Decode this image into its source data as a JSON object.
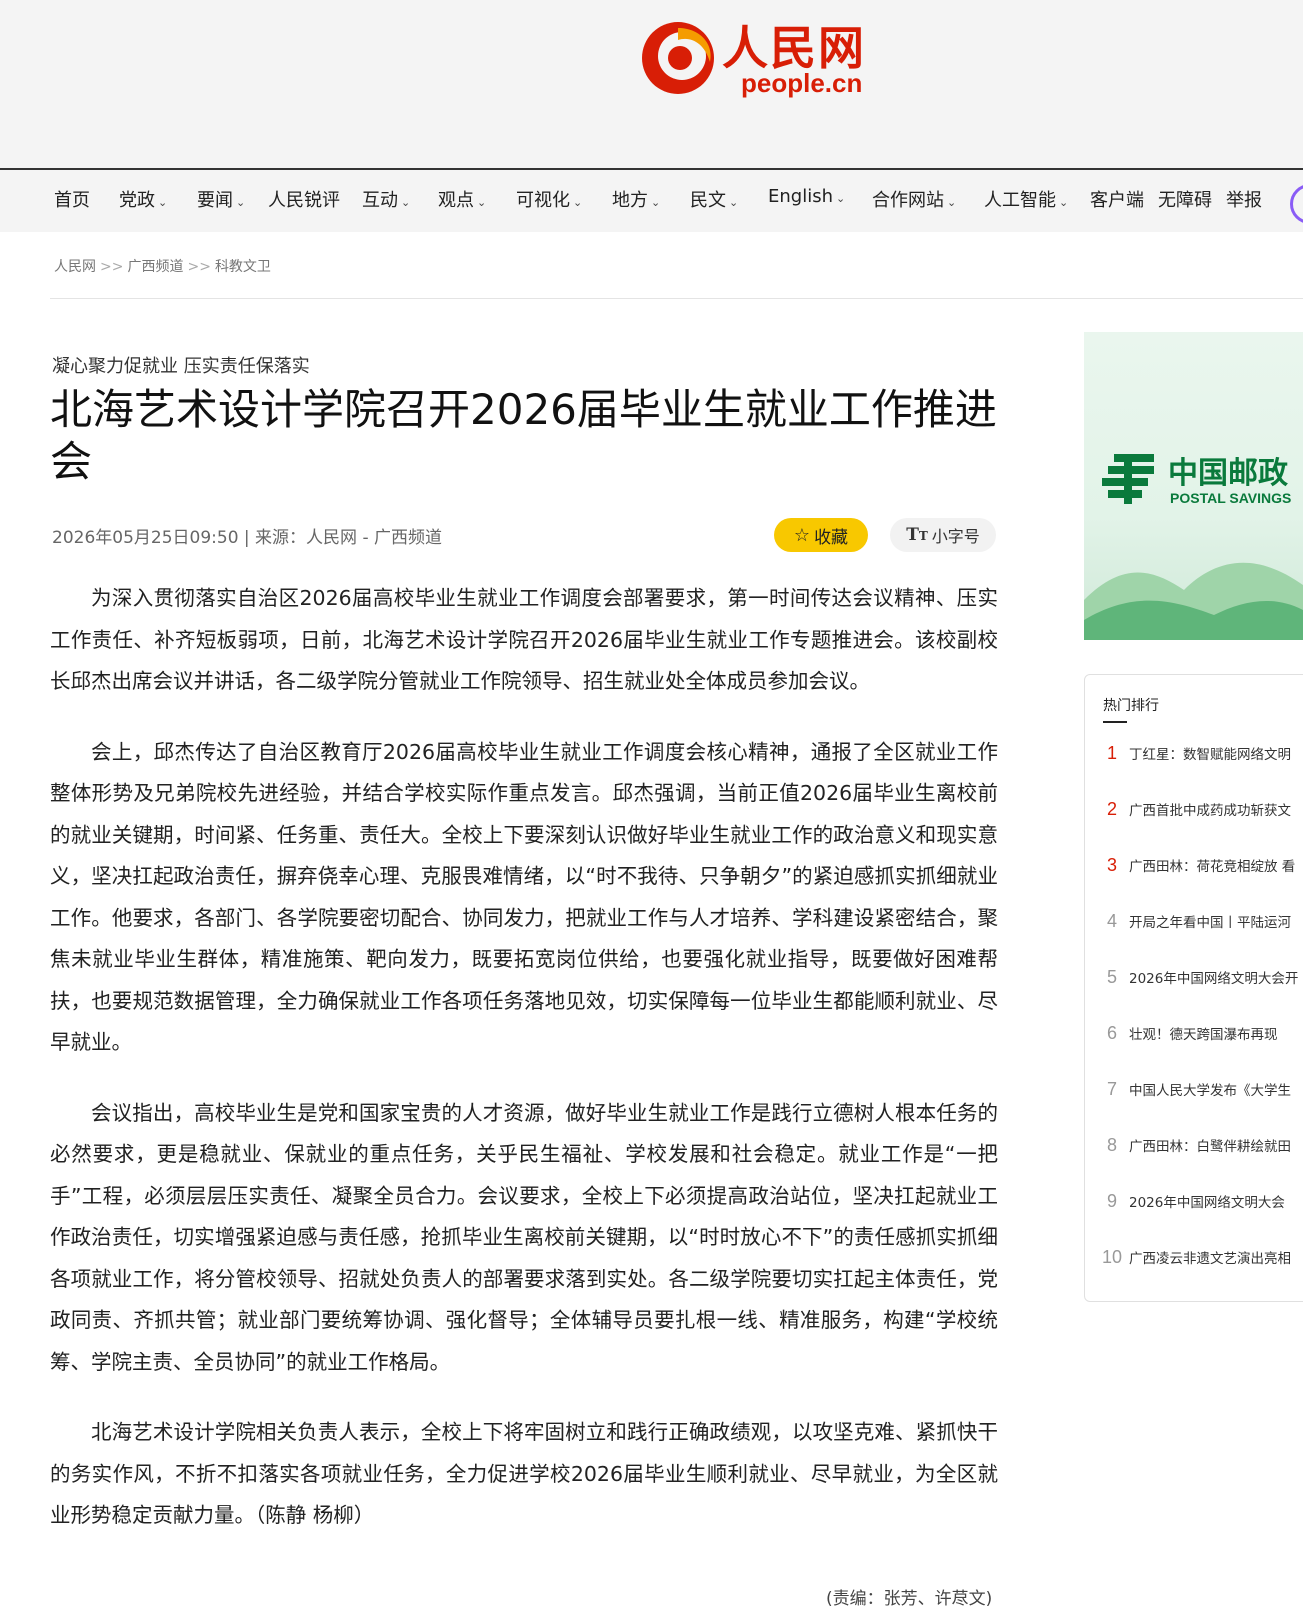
{
  "logo": {
    "cn": "人民网",
    "en": "people.cn"
  },
  "nav": [
    {
      "label": "首页",
      "dropdown": false
    },
    {
      "label": "党政",
      "dropdown": true
    },
    {
      "label": "要闻",
      "dropdown": true
    },
    {
      "label": "人民锐评",
      "dropdown": false
    },
    {
      "label": "互动",
      "dropdown": true
    },
    {
      "label": "观点",
      "dropdown": true
    },
    {
      "label": "可视化",
      "dropdown": true
    },
    {
      "label": "地方",
      "dropdown": true
    },
    {
      "label": "民文",
      "dropdown": true
    },
    {
      "label": "English",
      "dropdown": true
    },
    {
      "label": "合作网站",
      "dropdown": true
    },
    {
      "label": "人工智能",
      "dropdown": true
    },
    {
      "label": "客户端",
      "dropdown": false
    },
    {
      "label": "无障碍",
      "dropdown": false
    },
    {
      "label": "举报",
      "dropdown": false
    }
  ],
  "breadcrumb": {
    "items": [
      "人民网",
      "广西频道",
      "科教文卫"
    ],
    "separator": ">>"
  },
  "article": {
    "subtitle": "凝心聚力促就业 压实责任保落实",
    "title": "北海艺术设计学院召开2026届毕业生就业工作推进会",
    "meta": "2026年05月25日09:50 | 来源：人民网 - 广西频道",
    "favorite_label": "收藏",
    "font_size_label": "小字号",
    "paragraphs": [
      "为深入贯彻落实自治区2026届高校毕业生就业工作调度会部署要求，第一时间传达会议精神、压实工作责任、补齐短板弱项，日前，北海艺术设计学院召开2026届毕业生就业工作专题推进会。该校副校长邱杰出席会议并讲话，各二级学院分管就业工作院领导、招生就业处全体成员参加会议。",
      "会上，邱杰传达了自治区教育厅2026届高校毕业生就业工作调度会核心精神，通报了全区就业工作整体形势及兄弟院校先进经验，并结合学校实际作重点发言。邱杰强调，当前正值2026届毕业生离校前的就业关键期，时间紧、任务重、责任大。全校上下要深刻认识做好毕业生就业工作的政治意义和现实意义，坚决扛起政治责任，摒弃侥幸心理、克服畏难情绪，以“时不我待、只争朝夕”的紧迫感抓实抓细就业工作。他要求，各部门、各学院要密切配合、协同发力，把就业工作与人才培养、学科建设紧密结合，聚焦未就业毕业生群体，精准施策、靶向发力，既要拓宽岗位供给，也要强化就业指导，既要做好困难帮扶，也要规范数据管理，全力确保就业工作各项任务落地见效，切实保障每一位毕业生都能顺利就业、尽早就业。",
      "会议指出，高校毕业生是党和国家宝贵的人才资源，做好毕业生就业工作是践行立德树人根本任务的必然要求，更是稳就业、保就业的重点任务，关乎民生福祉、学校发展和社会稳定。就业工作是“一把手”工程，必须层层压实责任、凝聚全员合力。会议要求，全校上下必须提高政治站位，坚决扛起就业工作政治责任，切实增强紧迫感与责任感，抢抓毕业生离校前关键期，以“时时放心不下”的责任感抓实抓细各项就业工作，将分管校领导、招就处负责人的部署要求落到实处。各二级学院要切实扛起主体责任，党政同责、齐抓共管；就业部门要统筹协调、强化督导；全体辅导员要扎根一线、精准服务，构建“学校统筹、学院主责、全员协同”的就业工作格局。",
      "北海艺术设计学院相关负责人表示，全校上下将牢固树立和践行正确政绩观，以攻坚克难、紧抓快干的务实作风，不折不扣落实各项就业任务，全力促进学校2026届毕业生顺利就业、尽早就业，为全区就业形势稳定贡献力量。（陈静 杨柳）"
    ],
    "editor": "(责编：张芳、许荩文)"
  },
  "ad": {
    "cn": "中国邮政",
    "en": "POSTAL SAVINGS",
    "brand_color": "#0a7a3c"
  },
  "hot": {
    "title": "热门排行",
    "items": [
      {
        "rank": "1",
        "text": "丁红星：数智赋能网络文明"
      },
      {
        "rank": "2",
        "text": "广西首批中成药成功斩获文"
      },
      {
        "rank": "3",
        "text": "广西田林：荷花竞相绽放 看"
      },
      {
        "rank": "4",
        "text": "开局之年看中国丨平陆运河"
      },
      {
        "rank": "5",
        "text": "2026年中国网络文明大会开"
      },
      {
        "rank": "6",
        "text": "壮观！德天跨国瀑布再现"
      },
      {
        "rank": "7",
        "text": "中国人民大学发布《大学生"
      },
      {
        "rank": "8",
        "text": "广西田林：白鹭伴耕绘就田"
      },
      {
        "rank": "9",
        "text": "2026年中国网络文明大会"
      },
      {
        "rank": "10",
        "text": "广西凌云非遗文艺演出亮相"
      }
    ]
  },
  "colors": {
    "brand_red": "#d81e06",
    "favorite_yellow": "#f8c800",
    "search_purple": "#8a5cf6"
  }
}
